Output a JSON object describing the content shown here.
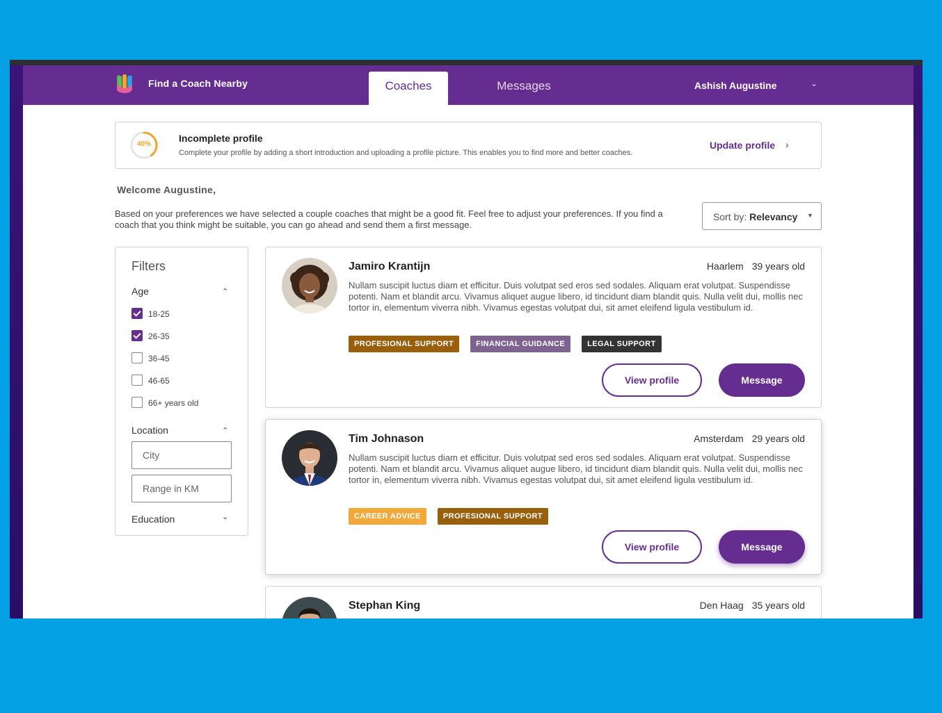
{
  "header": {
    "brand": "Find a Coach Nearby",
    "tabs": [
      {
        "label": "Coaches",
        "active": true
      },
      {
        "label": "Messages",
        "active": false
      }
    ],
    "user_name": "Ashish Augustine",
    "user_menu_icon": "chevron-down-icon"
  },
  "notice": {
    "progress_percent": 40,
    "progress_label": "40%",
    "title": "Incomplete profile",
    "description": "Complete your profile by adding a short introduction and uploading a profile picture. This enables you to find more and better coaches.",
    "link_label": "Update profile",
    "link_icon": "chevron-right-icon"
  },
  "welcome": "Welcome Augustine,",
  "intro": "Based on your preferences we have selected a couple coaches that might be a good fit. Feel free to adjust your preferences. If you find a coach that you think might be suitable, you can go ahead and send them a first message.",
  "sort": {
    "prefix": "Sort by:",
    "value": "Relevancy"
  },
  "filters": {
    "title": "Filters",
    "age": {
      "label": "Age",
      "options": [
        {
          "label": "18-25",
          "checked": true
        },
        {
          "label": "26-35",
          "checked": true
        },
        {
          "label": "36-45",
          "checked": false
        },
        {
          "label": "46-65",
          "checked": false
        },
        {
          "label": "66+ years old",
          "checked": false
        }
      ]
    },
    "location": {
      "label": "Location",
      "city_placeholder": "City",
      "range_placeholder": "Range in KM"
    },
    "education": {
      "label": "Education"
    }
  },
  "coaches": [
    {
      "name": "Jamiro Krantijn",
      "city": "Haarlem",
      "age": "39 years old",
      "description": "Nullam suscipit luctus diam et efficitur. Duis volutpat sed eros sed sodales. Aliquam erat volutpat. Suspendisse potenti. Nam et blandit arcu. Vivamus aliquet augue libero, id tincidunt diam blandit quis. Nulla velit dui, mollis nec tortor in, elementum viverra nibh. Vivamus egestas volutpat dui, sit amet eleifend ligula vestibulum id.",
      "tags": [
        {
          "label": "PROFESIONAL SUPPORT",
          "color": "#9a5f0a"
        },
        {
          "label": "FINANCIAL GUIDANCE",
          "color": "#7e6390"
        },
        {
          "label": "LEGAL SUPPORT",
          "color": "#333333"
        }
      ],
      "view_label": "View profile",
      "message_label": "Message"
    },
    {
      "name": "Tim Johnason",
      "city": "Amsterdam",
      "age": "29 years old",
      "description": "Nullam suscipit luctus diam et efficitur. Duis volutpat sed eros sed sodales. Aliquam erat volutpat. Suspendisse potenti. Nam et blandit arcu. Vivamus aliquet augue libero, id tincidunt diam blandit quis. Nulla velit dui, mollis nec tortor in, elementum viverra nibh. Vivamus egestas volutpat dui, sit amet eleifend ligula vestibulum id.",
      "tags": [
        {
          "label": "CAREER ADVICE",
          "color": "#f0a93a"
        },
        {
          "label": "PROFESIONAL SUPPORT",
          "color": "#9a5f0a"
        }
      ],
      "view_label": "View profile",
      "message_label": "Message"
    },
    {
      "name": "Stephan King",
      "city": "Den Haag",
      "age": "35 years old"
    }
  ],
  "colors": {
    "brand_purple": "#662d91",
    "background_blue": "#03a0e3",
    "progress_orange": "#f0a42c"
  }
}
